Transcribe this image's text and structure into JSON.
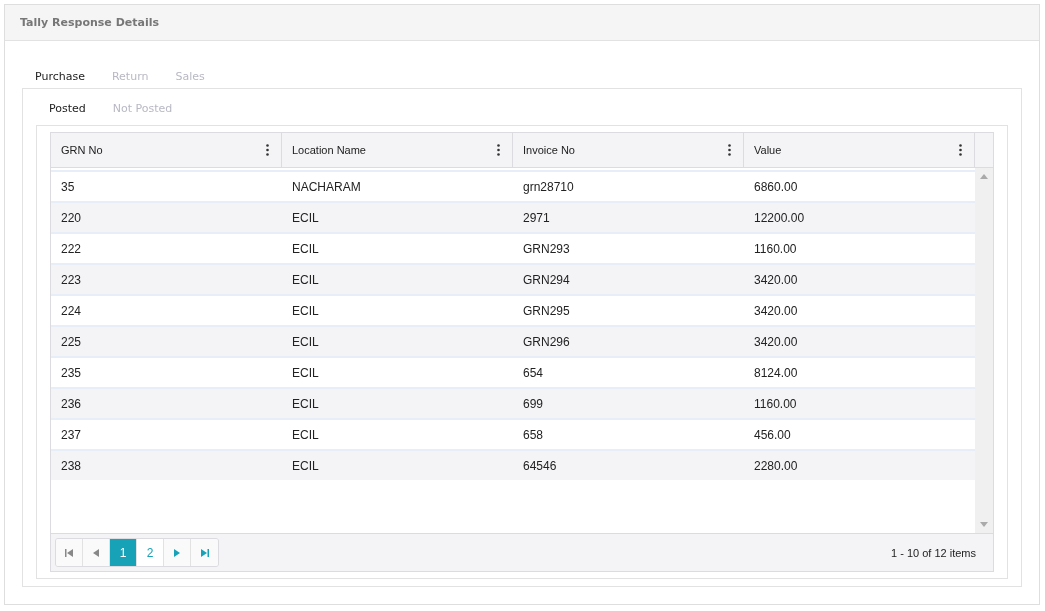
{
  "panel": {
    "title": "Tally Response Details"
  },
  "tabs": [
    {
      "label": "Purchase",
      "selected": true
    },
    {
      "label": "Return",
      "selected": false
    },
    {
      "label": "Sales",
      "selected": false
    }
  ],
  "subtabs": [
    {
      "label": "Posted",
      "selected": true
    },
    {
      "label": "Not Posted",
      "selected": false
    }
  ],
  "table": {
    "columns": [
      "GRN No",
      "Location Name",
      "Invoice No",
      "Value"
    ],
    "rows": [
      [
        "35",
        "NACHARAM",
        "grn28710",
        "6860.00"
      ],
      [
        "220",
        "ECIL",
        "2971",
        "12200.00"
      ],
      [
        "222",
        "ECIL",
        "GRN293",
        "1160.00"
      ],
      [
        "223",
        "ECIL",
        "GRN294",
        "3420.00"
      ],
      [
        "224",
        "ECIL",
        "GRN295",
        "3420.00"
      ],
      [
        "225",
        "ECIL",
        "GRN296",
        "3420.00"
      ],
      [
        "235",
        "ECIL",
        "654",
        "8124.00"
      ],
      [
        "236",
        "ECIL",
        "699",
        "1160.00"
      ],
      [
        "237",
        "ECIL",
        "658",
        "456.00"
      ],
      [
        "238",
        "ECIL",
        "64546",
        "2280.00"
      ]
    ]
  },
  "pager": {
    "buttons": [
      {
        "kind": "first"
      },
      {
        "kind": "prev"
      },
      {
        "kind": "page",
        "label": "1",
        "selected": true
      },
      {
        "kind": "page",
        "label": "2",
        "selected": false
      },
      {
        "kind": "next"
      },
      {
        "kind": "last"
      }
    ],
    "info": "1 - 10 of 12 items"
  }
}
